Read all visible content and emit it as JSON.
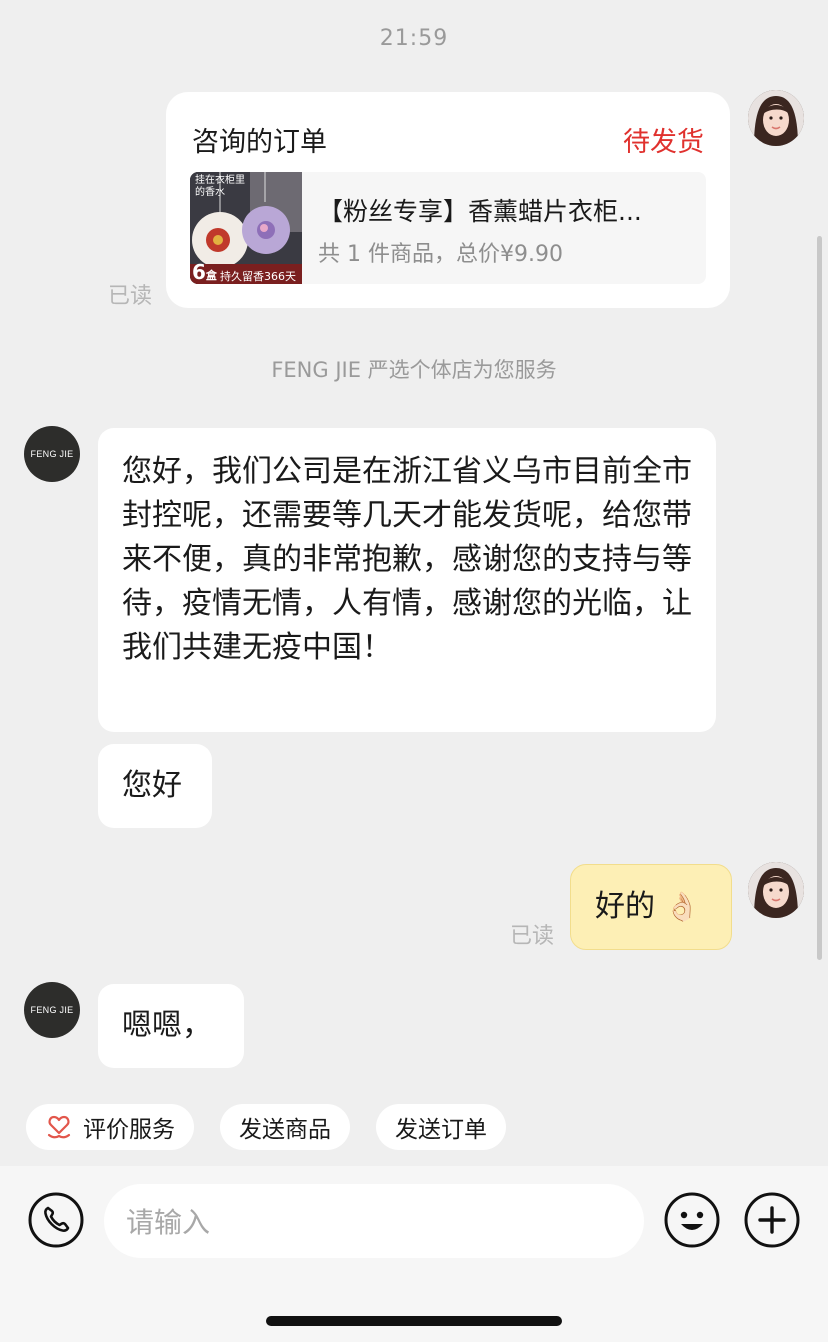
{
  "time": "21:59",
  "order_card": {
    "title": "咨询的订单",
    "status": "待发货",
    "status_color": "#e0312e",
    "product_name": "【粉丝专享】香薰蜡片衣柜...",
    "summary": "共 1 件商品，总价¥9.90",
    "thumb_text_top_line1": "挂在衣柜里",
    "thumb_text_top_line2": "的香水",
    "thumb_count": "6",
    "thumb_count_unit": "盒",
    "thumb_badge": "持久留香366天"
  },
  "read_label": "已读",
  "service_note": "FENG JIE 严选个体店为您服务",
  "shop_avatar": {
    "line": "FENG JIE"
  },
  "messages": [
    {
      "from": "shop",
      "text": "您好，我们公司是在浙江省义乌市目前全市封控呢，还需要等几天才能发货呢，给您带来不便，真的非常抱歉，感谢您的支持与等待，疫情无情，人有情，感谢您的光临，让我们共建无疫中国！"
    },
    {
      "from": "shop",
      "text": "您好"
    },
    {
      "from": "me",
      "text": "好的",
      "emoji": "👌🏻"
    },
    {
      "from": "shop",
      "text": "嗯嗯，"
    }
  ],
  "quick_actions": [
    {
      "label": "评价服务",
      "icon": "heart-hand-icon"
    },
    {
      "label": "发送商品"
    },
    {
      "label": "发送订单"
    }
  ],
  "input": {
    "placeholder": "请输入"
  },
  "icons": {
    "phone": "phone-icon",
    "emoji": "smiley-icon",
    "plus": "plus-circle-icon"
  }
}
